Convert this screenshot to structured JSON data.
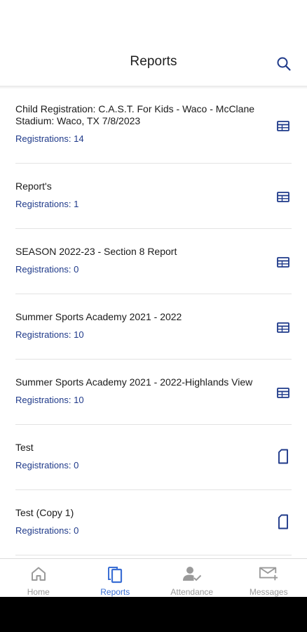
{
  "header": {
    "title": "Reports",
    "search_icon": "search-icon"
  },
  "reports": [
    {
      "title": "Child Registration: C.A.S.T. For Kids - Waco - McClane Stadium: Waco, TX 7/8/2023",
      "count": "Registrations: 14",
      "icon": "table-icon"
    },
    {
      "title": "Report's",
      "count": "Registrations: 1",
      "icon": "table-icon"
    },
    {
      "title": "SEASON 2022-23 - Section 8 Report",
      "count": "Registrations: 0",
      "icon": "table-icon"
    },
    {
      "title": "Summer Sports Academy 2021 - 2022",
      "count": "Registrations: 10",
      "icon": "table-icon"
    },
    {
      "title": "Summer Sports Academy 2021 - 2022-Highlands View",
      "count": "Registrations: 10",
      "icon": "table-icon"
    },
    {
      "title": "Test",
      "count": "Registrations: 0",
      "icon": "document-icon"
    },
    {
      "title": "Test (Copy 1)",
      "count": "Registrations: 0",
      "icon": "document-icon"
    }
  ],
  "nav": {
    "items": [
      {
        "label": "Home",
        "icon": "home-icon",
        "active": false
      },
      {
        "label": "Reports",
        "icon": "reports-icon",
        "active": true
      },
      {
        "label": "Attendance",
        "icon": "attendance-icon",
        "active": false
      },
      {
        "label": "Messages",
        "icon": "messages-icon",
        "active": false
      }
    ]
  },
  "colors": {
    "accent": "#1f3a8a",
    "active_nav": "#3b6fd4",
    "inactive_nav": "#9a9a9a",
    "divider": "#e3e3e3"
  }
}
